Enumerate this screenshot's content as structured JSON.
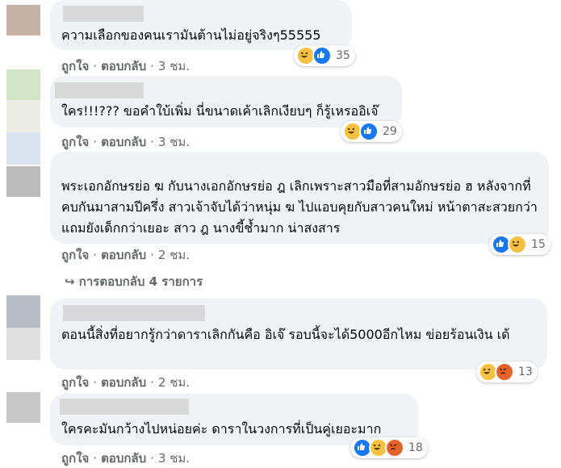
{
  "comments": [
    {
      "text": "ความเลือกของคนเรามันต้านไม่อยู่จริงๆ55555",
      "like": "ถูกใจ",
      "reply": "ตอบกลับ",
      "sep": "·",
      "time": "3 ชม.",
      "reactions": [
        "haha",
        "like"
      ],
      "count": "35"
    },
    {
      "text": "ใคร!!!??? ขอคำใบ้เพิ่ม นี่ขนาดเค้าเลิกเงียบๆ ก็รู้เหรออิเจ๊",
      "like": "ถูกใจ",
      "reply": "ตอบกลับ",
      "sep": "·",
      "time": "3 ชม.",
      "reactions": [
        "haha",
        "like"
      ],
      "count": "29"
    },
    {
      "text": "พระเอกอักษรย่อ ฆ กับนางเอกอักษรย่อ ฎ เลิกเพราะสาวมือที่สามอักษรย่อ ฮ หลังจากที่คบกันมาสามปีครึ่ง สาวเจ้าจับได้ว่าหนุ่ม ฆ ไปแอบคุยกับสาวคนใหม่ หน้าตาสะสวยกว่าแถมยังเด็กกว่าเยอะ สาว ฎ นางขี้ช้ำมาก น่าสงสาร",
      "like": "ถูกใจ",
      "reply": "ตอบกลับ",
      "sep": "·",
      "time": "2 ชม.",
      "reactions": [
        "like",
        "haha"
      ],
      "count": "15"
    },
    {
      "text": "ตอนนี้สิ่งที่อยากรู้กว่าดาราเลิกกันคือ อิเจ๊ รอบนี้จะได้5000อีกไหม ข่อยร้อนเงิน เด้",
      "like": "ถูกใจ",
      "reply": "ตอบกลับ",
      "sep": "·",
      "time": "2 ชม.",
      "reactions": [
        "haha",
        "angry"
      ],
      "count": "13"
    },
    {
      "text": "ใครคะมันกว้างไปหน่อยค่ะ ดาราในวงการที่เป็นคู่เยอะมาก",
      "like": "ถูกใจ",
      "reply": "ตอบกลับ",
      "sep": "·",
      "time": "3 ชม.",
      "reactions": [
        "like",
        "haha",
        "angry"
      ],
      "count": "18"
    }
  ],
  "view_replies": "↪ การตอบกลับ 4 รายการ",
  "colors": {
    "haha": "#f7c244",
    "like": "#1877f2",
    "angry": "#e5622a",
    "bubble": "#f0f2f5",
    "meta": "#65676b"
  }
}
